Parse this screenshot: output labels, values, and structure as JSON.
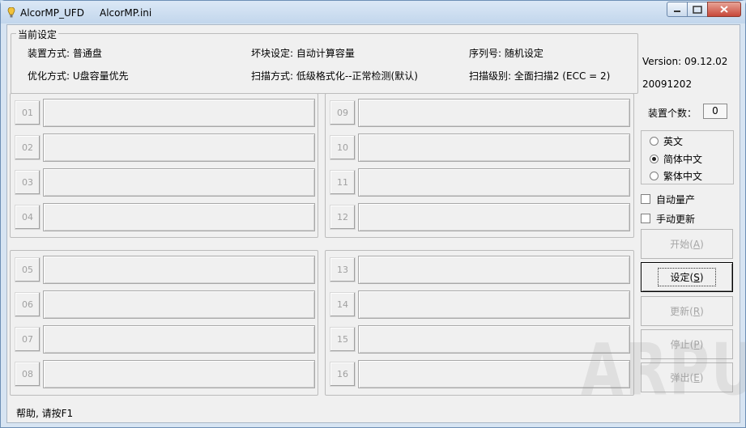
{
  "window": {
    "title": "AlcorMP_UFD     AlcorMP.ini"
  },
  "settings": {
    "legend": "当前设定",
    "mount_mode": "装置方式: 普通盘",
    "bad_block": "坏块设定: 自动计算容量",
    "serial": "序列号: 随机设定",
    "optimize": "优化方式: U盘容量优先",
    "scan_mode": "扫描方式: 低级格式化--正常检测(默认)",
    "scan_level": "扫描级别: 全面扫描2 (ECC = 2)"
  },
  "ports": {
    "group1": [
      "01",
      "02",
      "03",
      "04"
    ],
    "group2": [
      "09",
      "10",
      "11",
      "12"
    ],
    "group3": [
      "05",
      "06",
      "07",
      "08"
    ],
    "group4": [
      "13",
      "14",
      "15",
      "16"
    ]
  },
  "side": {
    "version": "Version: 09.12.02",
    "build": "20091202",
    "device_count_label": "装置个数：",
    "device_count": "0",
    "languages": [
      {
        "label": "英文",
        "selected": false
      },
      {
        "label": "简体中文",
        "selected": true
      },
      {
        "label": "繁体中文",
        "selected": false
      }
    ],
    "auto_produce": "自动量产",
    "manual_update": "手动更新",
    "buttons": {
      "start": {
        "label": "开始",
        "mnemonic": "A"
      },
      "settings": {
        "label": "设定",
        "mnemonic": "S"
      },
      "update": {
        "label": "更新",
        "mnemonic": "R"
      },
      "stop": {
        "label": "停止",
        "mnemonic": "P"
      },
      "eject": {
        "label": "弹出",
        "mnemonic": "E"
      }
    }
  },
  "status": "帮助, 请按F1",
  "watermark": "ARPUN"
}
